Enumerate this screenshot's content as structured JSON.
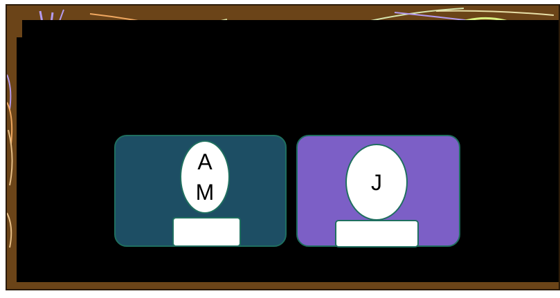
{
  "participants": [
    {
      "initials": "AM",
      "name": "",
      "color": "#1d4e64"
    },
    {
      "initials": "J",
      "name": "",
      "color": "#7c5fc6"
    }
  ],
  "theme": {
    "frame_color": "#6b4418",
    "board_color": "#000000",
    "card_border": "#1f6f5f"
  }
}
